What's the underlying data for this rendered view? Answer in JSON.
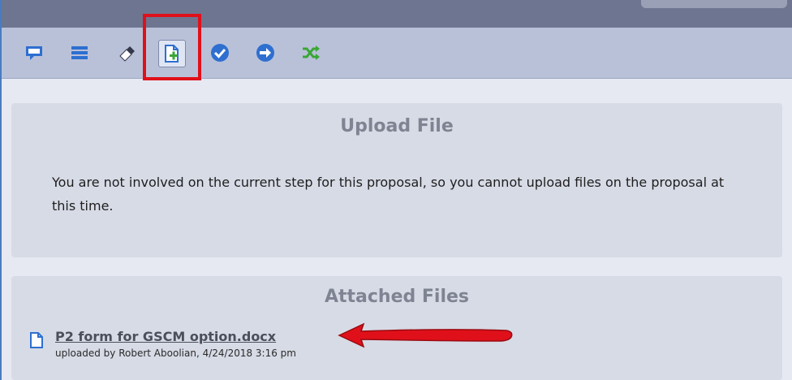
{
  "toolbar": {
    "icons": [
      "comment-icon",
      "list-icon",
      "eraser-icon",
      "add-file-icon",
      "approve-check-icon",
      "forward-arrow-icon",
      "shuffle-icon"
    ],
    "selected": "add-file-icon"
  },
  "upload": {
    "title": "Upload File",
    "message": "You are not involved on the current step for this proposal, so you cannot upload files on the proposal at this time."
  },
  "attached": {
    "title": "Attached Files",
    "files": [
      {
        "name": "P2 form for GSCM option.docx",
        "meta": "uploaded by Robert Aboolian,  4/24/2018 3:16 pm"
      }
    ]
  },
  "colors": {
    "accent_blue": "#2e6fd0",
    "green": "#3aa635",
    "annotation_red": "#e0101a"
  }
}
